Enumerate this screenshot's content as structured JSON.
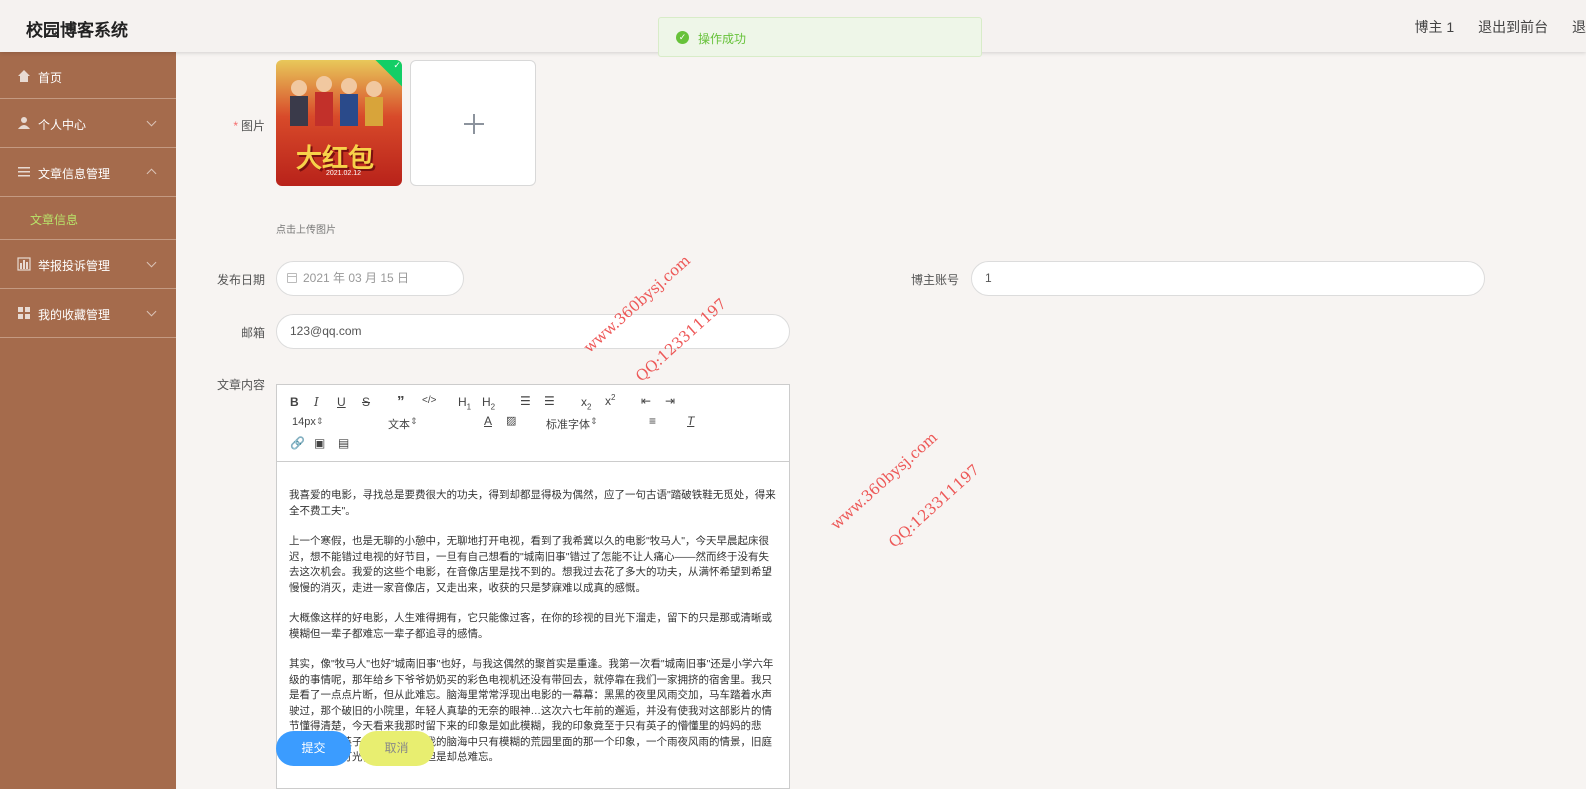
{
  "app": {
    "title": "校园博客系统"
  },
  "header": {
    "user": "博主 1",
    "to_front": "退出到前台",
    "logout": "退出"
  },
  "toast": {
    "message": "操作成功"
  },
  "sidebar": {
    "items": [
      {
        "label": "首页",
        "icon": "home-icon"
      },
      {
        "label": "个人中心",
        "icon": "user-icon"
      },
      {
        "label": "文章信息管理",
        "icon": "list-icon"
      },
      {
        "label": "文章信息",
        "sub": true
      },
      {
        "label": "举报投诉管理",
        "icon": "chart-icon"
      },
      {
        "label": "我的收藏管理",
        "icon": "grid-icon"
      }
    ]
  },
  "form": {
    "image_label": "图片",
    "upload_tip": "点击上传图片",
    "poster_title": "大红包",
    "poster_date": "2021.02.12",
    "date_label": "发布日期",
    "date_value": "2021 年 03 月 15 日",
    "account_label": "博主账号",
    "account_value": "1",
    "email_label": "邮箱",
    "email_value": "123@qq.com",
    "content_label": "文章内容"
  },
  "editor": {
    "font_size": "14px",
    "text_type": "文本",
    "font_family": "标准字体",
    "paragraphs": [
      "我喜爱的电影，寻找总是要费很大的功夫，得到却都显得极为偶然，应了一句古语\"踏破铁鞋无觅处，得来全不费工夫\"。",
      "上一个寒假，也是无聊的小憩中，无聊地打开电视，看到了我希冀以久的电影\"牧马人\"，今天早晨起床很迟，想不能错过电视的好节目，一旦有自己想看的\"城南旧事\"错过了怎能不让人痛心——然而终于没有失去这次机会。我爱的这些个电影，在音像店里是找不到的。想我过去花了多大的功夫，从满怀希望到希望慢慢的消灭，走进一家音像店，又走出来，收获的只是梦寐难以成真的感慨。",
      "大概像这样的好电影，人生难得拥有，它只能像过客，在你的珍视的目光下溜走，留下的只是那或清晰或模糊但一辈子都难忘一辈子都追寻的感情。",
      "其实，像\"牧马人\"也好\"城南旧事\"也好，与我这偶然的聚首实是重逢。我第一次看\"城南旧事\"还是小学六年级的事情呢，那年给乡下爷爷奶奶买的彩色电视机还没有带回去，就停靠在我们一家拥挤的宿舍里。我只是看了一点点片断，但从此难忘。脑海里常常浮现出电影的一幕幕：黑黑的夜里风雨交加，马车踏着水声驶过，那个破旧的小院里，年轻人真挚的无奈的眼神…这次六七年前的邂逅，并没有使我对这部影片的情节懂得清楚，今天看来我那时留下来的印象是如此模糊，我的印象竟至于只有英子的懵懂里的妈妈的悲恸，忽略了英子爸爸的伤逝…我的脑海中只有模糊的荒园里面的那一个印象，一个雨夜风雨的情景，旧庭院里昏黄的灯光，只此而已，但是却总难忘。"
    ]
  },
  "actions": {
    "submit": "提交",
    "cancel": "取消"
  },
  "watermarks": [
    {
      "site": "www.360bysj.com",
      "qq": "QQ:123311197"
    },
    {
      "site": "www.360bysj.com",
      "qq": "QQ:123311197"
    }
  ]
}
